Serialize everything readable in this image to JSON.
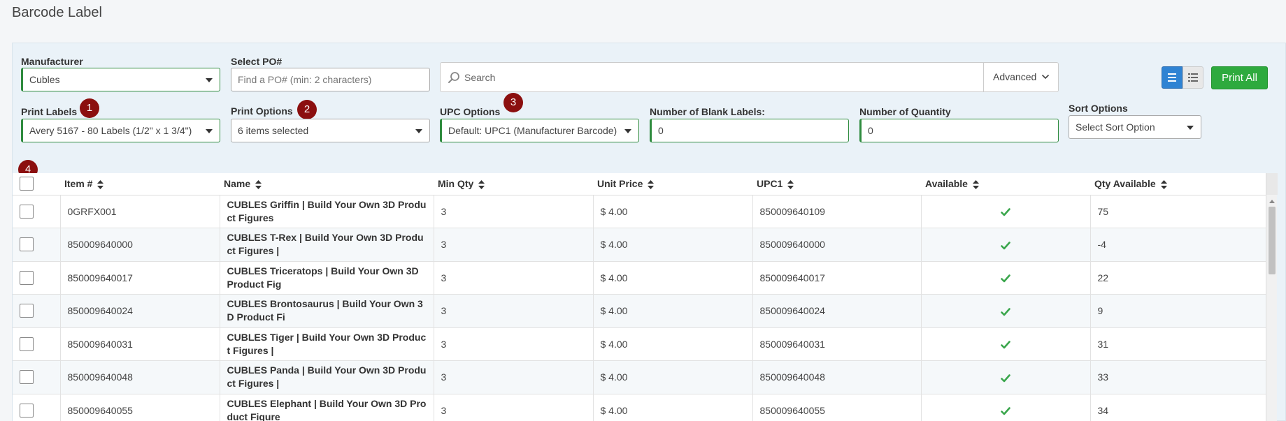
{
  "page": {
    "title": "Barcode Label"
  },
  "filters": {
    "manufacturer": {
      "label": "Manufacturer",
      "value": "Cubles"
    },
    "po": {
      "label": "Select PO#",
      "placeholder": "Find a PO# (min: 2 characters)"
    },
    "search": {
      "placeholder": "Search",
      "advanced_label": "Advanced"
    },
    "print_labels": {
      "label": "Print Labels",
      "value": "Avery 5167 - 80 Labels (1/2\" x 1 3/4\")"
    },
    "print_options": {
      "label": "Print Options",
      "value": "6 items selected"
    },
    "upc_options": {
      "label": "UPC Options",
      "value": "Default: UPC1 (Manufacturer Barcode)"
    },
    "blank_labels": {
      "label": "Number of Blank Labels:",
      "value": "0"
    },
    "quantity": {
      "label": "Number of Quantity",
      "value": "0"
    },
    "sort": {
      "label": "Sort Options",
      "value": "Select Sort Option"
    }
  },
  "toolbar": {
    "print_all_label": "Print All"
  },
  "badges": [
    "1",
    "2",
    "3",
    "4"
  ],
  "colors": {
    "accent_green": "#2eaa3e",
    "accent_blue": "#2f83d3",
    "badge_red": "#8b0f0f",
    "check_green": "#3aa64c"
  },
  "table": {
    "columns": [
      "Item #",
      "Name",
      "Min Qty",
      "Unit Price",
      "UPC1",
      "Available",
      "Qty Available"
    ],
    "rows": [
      {
        "item": "0GRFX001",
        "name": "CUBLES Griffin | Build Your Own 3D Product Figures",
        "min_qty": "3",
        "price": "$ 4.00",
        "upc": "850009640109",
        "available": true,
        "qty": "75"
      },
      {
        "item": "850009640000",
        "name": "CUBLES T-Rex | Build Your Own 3D Product Figures |",
        "min_qty": "3",
        "price": "$ 4.00",
        "upc": "850009640000",
        "available": true,
        "qty": "-4"
      },
      {
        "item": "850009640017",
        "name": "CUBLES Triceratops | Build Your Own 3D Product Fig",
        "min_qty": "3",
        "price": "$ 4.00",
        "upc": "850009640017",
        "available": true,
        "qty": "22"
      },
      {
        "item": "850009640024",
        "name": "CUBLES Brontosaurus | Build Your Own 3D Product Fi",
        "min_qty": "3",
        "price": "$ 4.00",
        "upc": "850009640024",
        "available": true,
        "qty": "9"
      },
      {
        "item": "850009640031",
        "name": "CUBLES Tiger | Build Your Own 3D Product Figures |",
        "min_qty": "3",
        "price": "$ 4.00",
        "upc": "850009640031",
        "available": true,
        "qty": "31"
      },
      {
        "item": "850009640048",
        "name": "CUBLES Panda | Build Your Own 3D Product Figures |",
        "min_qty": "3",
        "price": "$ 4.00",
        "upc": "850009640048",
        "available": true,
        "qty": "33"
      },
      {
        "item": "850009640055",
        "name": "CUBLES Elephant | Build Your Own 3D Product Figure",
        "min_qty": "3",
        "price": "$ 4.00",
        "upc": "850009640055",
        "available": true,
        "qty": "34"
      }
    ]
  }
}
